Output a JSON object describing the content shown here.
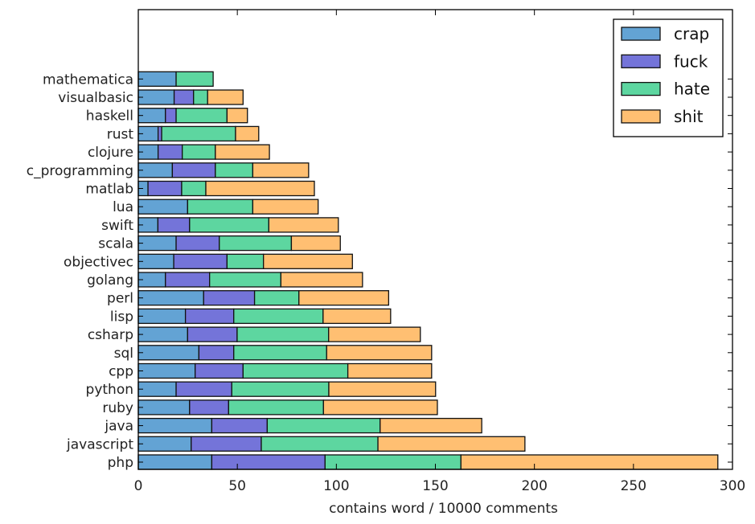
{
  "chart_data": {
    "type": "bar",
    "orientation": "horizontal",
    "stacked": true,
    "title": "",
    "xlabel": "contains word / 10000 comments",
    "ylabel": "",
    "xlim": [
      0,
      300
    ],
    "xticks": [
      0,
      50,
      100,
      150,
      200,
      250,
      300
    ],
    "grid": false,
    "legend_position": "top-right",
    "categories": [
      "php",
      "javascript",
      "java",
      "ruby",
      "python",
      "cpp",
      "sql",
      "csharp",
      "lisp",
      "perl",
      "golang",
      "objectivec",
      "scala",
      "swift",
      "lua",
      "matlab",
      "c_programming",
      "clojure",
      "rust",
      "haskell",
      "visualbasic",
      "mathematica"
    ],
    "series": [
      {
        "name": "crap",
        "color": "#63a3d4",
        "values": [
          37.1,
          26.7,
          37.1,
          25.9,
          19.1,
          28.7,
          30.6,
          24.9,
          23.8,
          33.0,
          13.7,
          17.9,
          19.1,
          9.9,
          24.9,
          4.9,
          17.2,
          10.0,
          10.0,
          13.7,
          18.1,
          19.1
        ]
      },
      {
        "name": "fuck",
        "color": "#7474d9",
        "values": [
          57.2,
          35.4,
          28.0,
          19.7,
          28.1,
          24.2,
          17.6,
          25.0,
          24.4,
          25.7,
          22.3,
          26.9,
          21.8,
          16.0,
          0,
          17.0,
          21.7,
          12.2,
          1.8,
          5.4,
          9.8,
          0
        ]
      },
      {
        "name": "hate",
        "color": "#5dd6a0",
        "values": [
          68.6,
          58.9,
          57.0,
          47.9,
          49.0,
          52.9,
          46.9,
          46.2,
          45.1,
          22.4,
          36.0,
          18.4,
          36.4,
          40.0,
          32.9,
          12.2,
          18.9,
          16.7,
          37.3,
          25.7,
          7.1,
          18.7
        ]
      },
      {
        "name": "shit",
        "color": "#ffbf72",
        "values": [
          129.7,
          74.2,
          51.3,
          57.5,
          53.9,
          42.3,
          53.0,
          46.3,
          34.1,
          45.3,
          41.2,
          44.9,
          24.7,
          35.1,
          33.0,
          54.8,
          28.2,
          27.3,
          11.7,
          10.3,
          17.9,
          0
        ]
      }
    ]
  }
}
